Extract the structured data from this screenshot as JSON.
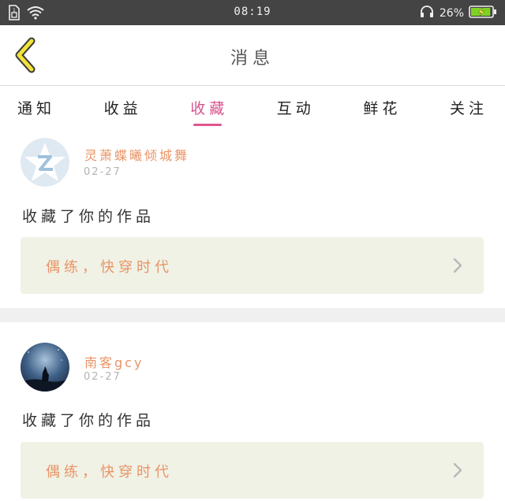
{
  "status_bar": {
    "time": "08:19",
    "battery_percent_text": "26%",
    "battery_level": 0.26,
    "icons": [
      "sim-card-icon",
      "wifi-icon",
      "headset-icon",
      "battery-charging-icon"
    ]
  },
  "header": {
    "title": "消息",
    "back_icon": "chevron-left-icon"
  },
  "tabs": [
    {
      "label": "通知",
      "active": false
    },
    {
      "label": "收益",
      "active": false
    },
    {
      "label": "收藏",
      "active": true
    },
    {
      "label": "互动",
      "active": false
    },
    {
      "label": "鲜花",
      "active": false
    },
    {
      "label": "关注",
      "active": false
    }
  ],
  "notifications": [
    {
      "user_name": "灵萧蝶曦倾城舞",
      "date": "02-27",
      "action": "收藏了你的作品",
      "work_title": "偶练，快穿时代",
      "avatar_icon": "default-avatar-icon"
    },
    {
      "user_name": "南客gcy",
      "date": "02-27",
      "action": "收藏了你的作品",
      "work_title": "偶练，快穿时代",
      "avatar_icon": "wolf-avatar-image"
    }
  ],
  "colors": {
    "status_bar_bg": "#444444",
    "accent_pink": "#e0568f",
    "accent_orange": "#e99466",
    "back_arrow_yellow": "#f2e23a",
    "work_box_bg": "#f0f2e6",
    "battery_green": "#7ed321"
  }
}
